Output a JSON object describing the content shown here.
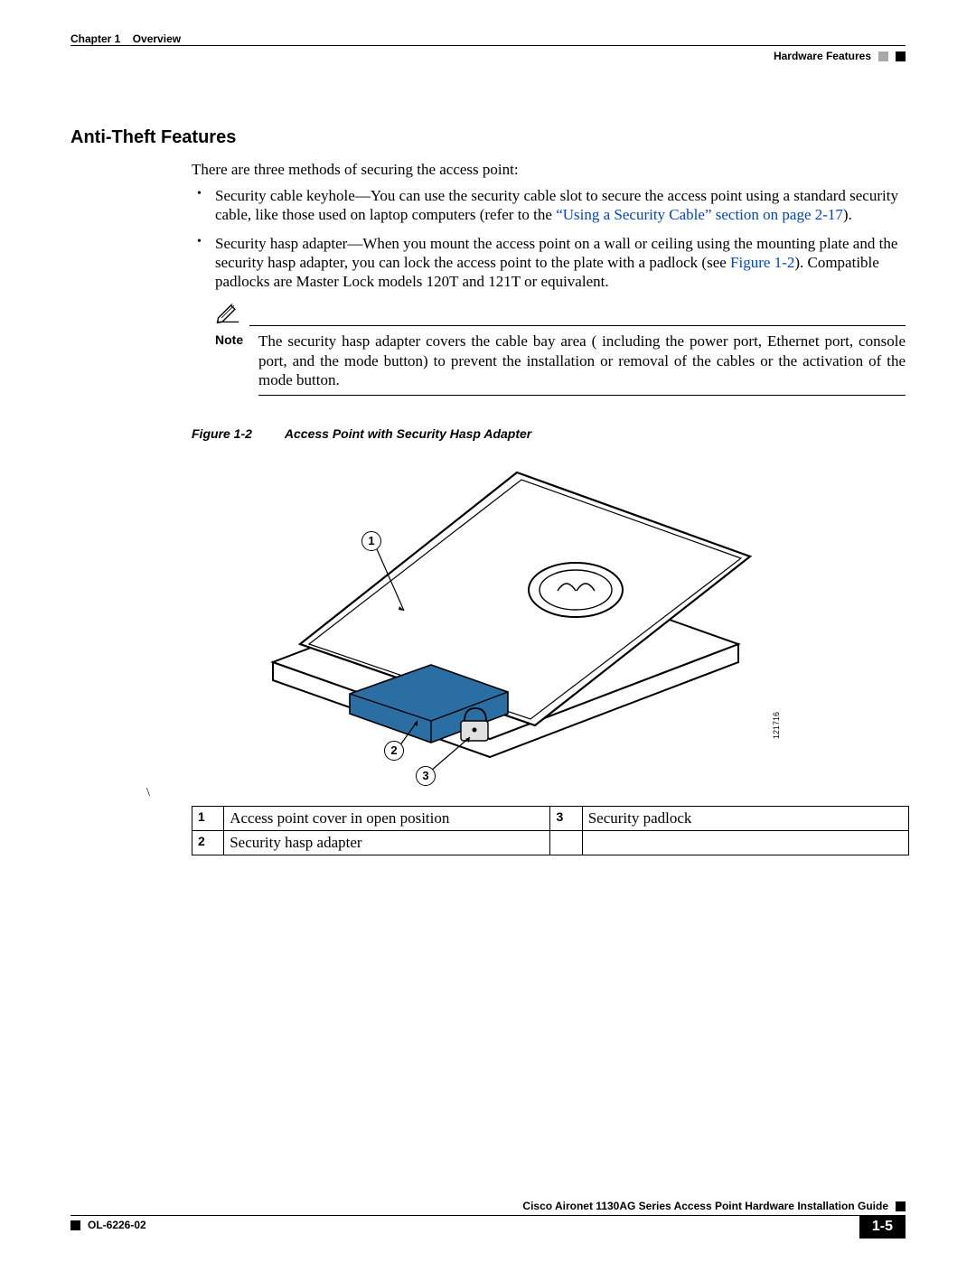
{
  "header": {
    "chapter": "Chapter 1",
    "chapter_title": "Overview",
    "section": "Hardware Features"
  },
  "title": "Anti-Theft Features",
  "intro": "There are three methods of securing the access point:",
  "bullets": {
    "b1_a": "Security cable keyhole—You can use the security cable slot to secure the access point using a standard security cable, like those used on laptop computers (refer to the ",
    "b1_link": "“Using a Security Cable” section on page 2-17",
    "b1_b": ").",
    "b2_a": "Security hasp adapter—When you mount the access point on a wall or ceiling using the mounting plate and the security hasp adapter, you can lock the access point to the plate with a padlock (see ",
    "b2_link": "Figure 1-2",
    "b2_b": "). Compatible padlocks are Master Lock models 120T and 121T or equivalent."
  },
  "note": {
    "label": "Note",
    "text": "The security hasp adapter covers the cable bay area ( including the power port, Ethernet port, console port, and the mode button) to prevent the installation or removal of the cables or the activation of the mode button."
  },
  "figure": {
    "num": "Figure 1-2",
    "title": "Access Point with Security Hasp Adapter",
    "id": "121716",
    "callouts": {
      "c1": "1",
      "c2": "2",
      "c3": "3"
    }
  },
  "slash": "\\",
  "legend": {
    "r1n": "1",
    "r1t": "Access point cover in open position",
    "r2n": "3",
    "r2t": "Security padlock",
    "r3n": "2",
    "r3t": "Security hasp adapter"
  },
  "footer": {
    "guide": "Cisco Aironet 1130AG Series Access Point Hardware Installation Guide",
    "doc": "OL-6226-02",
    "page": "1-5"
  }
}
